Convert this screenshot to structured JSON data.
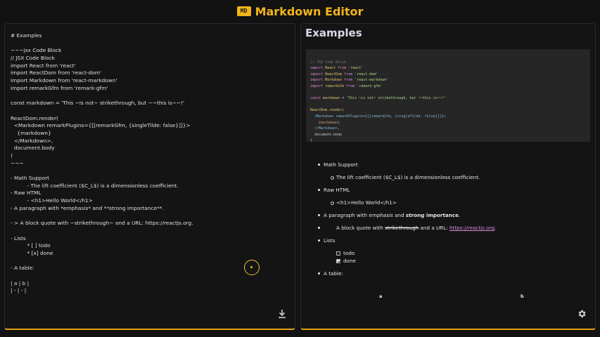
{
  "header": {
    "logo_text": "MD",
    "title": "Markdown Editor"
  },
  "editor": {
    "lines": [
      "# Examples",
      "",
      "~~~jsx Code Block",
      "// JSX Code Block",
      "import React from 'react'",
      "import ReactDom from 'react-dom'",
      "import Markdown from 'react-markdown'",
      "import remarkGfm from 'remark-gfm'",
      "",
      "const markdown = 'This ~is not~ strikethrough, but ~~this is~~!'",
      "",
      "ReactDom.render(",
      "  <Markdown remarkPlugins={[[remarkGfm, {singleTilde: false}]]}>",
      "    {markdown}",
      "  </Markdown>,",
      "  document.body",
      ")",
      "~~~",
      "",
      "- Math Support",
      "          - The lift coefficient ($C_L$) is a dimensionless coefficient.",
      "- Raw HTML",
      "          - <h1>Hello World</h1>",
      "- A paragraph with *emphasis* and **strong importance**.",
      "",
      "- > A block quote with ~strikethrough~ and a URL: https://reactjs.org.",
      "",
      "- Lists",
      "          * [ ] todo",
      "          * [x] done",
      "",
      "- A table:",
      "",
      "| a | b |",
      "| - | - |"
    ]
  },
  "preview": {
    "title": "Examples",
    "code": {
      "comment": "// JSX Code Block",
      "imports": [
        {
          "kw": "import",
          "name": "React",
          "from": "from",
          "src": "'react'"
        },
        {
          "kw": "import",
          "name": "ReactDom",
          "from": "from",
          "src": "'react-dom'"
        },
        {
          "kw": "import",
          "name": "Markdown",
          "from": "from",
          "src": "'react-markdown'"
        },
        {
          "kw": "import",
          "name": "remarkGfm",
          "from": "from",
          "src": "'remark-gfm'"
        }
      ],
      "const_line": {
        "kw": "const",
        "name": "markdown",
        "eq": " = ",
        "str": "'This ~is not~ strikethrough, but ~~this is~~!'"
      },
      "render_lines": [
        "ReactDom.render(",
        "  <Markdown remarkPlugins={[[remarkGfm, {singleTilde: false}]]}>",
        "    {markdown}",
        "  </Markdown>,",
        "  document.body",
        ")"
      ]
    },
    "list": {
      "math": "Math Support",
      "math_sub": "The lift coefficient ($C_L$) is a dimensionless coefficient.",
      "raw": "Raw HTML",
      "raw_sub": "<h1>Hello World</h1>",
      "para_a": "A paragraph with ",
      "para_em": "emphasis",
      "para_b": " and ",
      "para_strong": "strong importance",
      "para_c": ".",
      "quote_a": "A block quote with ",
      "quote_strike": "strikethrough",
      "quote_b": " and a URL: ",
      "quote_link": "https://reactjs.org",
      "quote_c": ".",
      "lists": "Lists",
      "todo": "todo",
      "done": "done",
      "table": "A table:"
    },
    "table_headers": [
      "a",
      "b"
    ]
  },
  "icons": {
    "download": "download-icon",
    "settings": "gear-icon"
  },
  "colors": {
    "accent": "#f2b41c",
    "link": "#d48ad4",
    "background": "#121212"
  }
}
